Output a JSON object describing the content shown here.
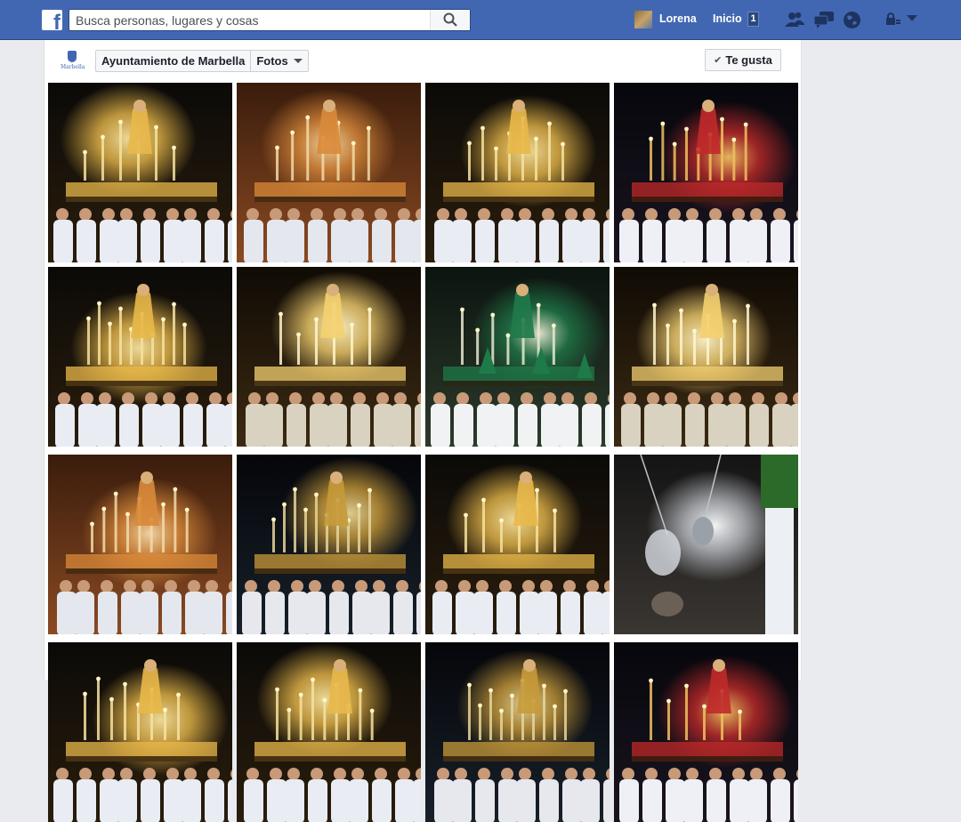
{
  "topbar": {
    "logo_glyph": "f",
    "search_placeholder": "Busca personas, lugares y cosas",
    "user_name": "Lorena",
    "home_label": "Inicio",
    "home_badge": "1",
    "icons": [
      "friends-icon",
      "messages-icon",
      "notifications-globe-icon",
      "privacy-lock-icon",
      "account-caret-icon"
    ]
  },
  "page": {
    "logo_caption": "Marbella",
    "breadcrumb_page": "Ayuntamiento de Marbella",
    "breadcrumb_section": "Fotos",
    "like_label": "Te gusta"
  },
  "photos": [
    {
      "theme": "gold"
    },
    {
      "theme": "warm"
    },
    {
      "theme": "gold"
    },
    {
      "theme": "red"
    },
    {
      "theme": "gold"
    },
    {
      "theme": "candle"
    },
    {
      "theme": "green"
    },
    {
      "theme": "candle"
    },
    {
      "theme": "warm"
    },
    {
      "theme": "dark"
    },
    {
      "theme": "gold"
    },
    {
      "theme": "censer"
    },
    {
      "theme": "gold"
    },
    {
      "theme": "gold"
    },
    {
      "theme": "dark"
    },
    {
      "theme": "red"
    }
  ],
  "colors": {
    "brand": "#4267b2",
    "brand_dark": "#29487d",
    "page_bg": "#e9ebee"
  }
}
